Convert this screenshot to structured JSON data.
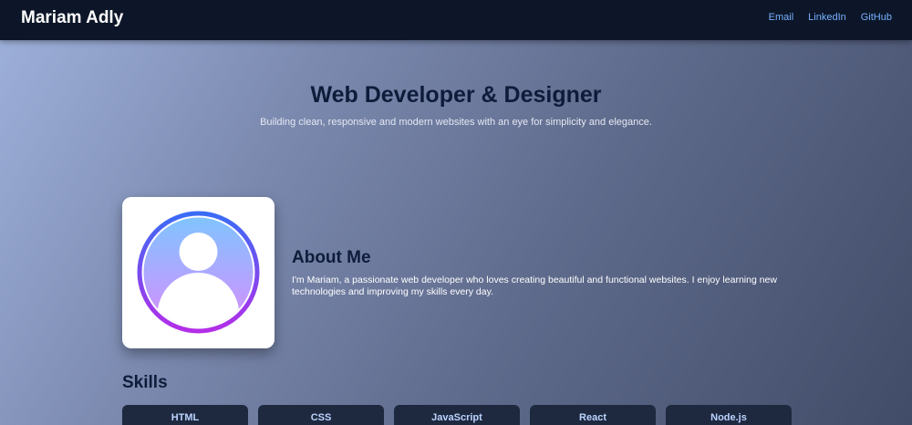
{
  "header": {
    "brand": "Mariam Adly",
    "links": [
      {
        "label": "Email"
      },
      {
        "label": "LinkedIn"
      },
      {
        "label": "GitHub"
      }
    ]
  },
  "hero": {
    "title": "Web Developer & Designer",
    "subtitle": "Building clean, responsive and modern websites with an eye for simplicity and elegance."
  },
  "about": {
    "title": "About Me",
    "text": "I'm Mariam, a passionate web developer who loves creating beautiful and functional websites. I enjoy learning new technologies and improving my skills every day."
  },
  "skills": {
    "title": "Skills",
    "items": [
      {
        "label": "HTML"
      },
      {
        "label": "CSS"
      },
      {
        "label": "JavaScript"
      },
      {
        "label": "React"
      },
      {
        "label": "Node.js"
      }
    ]
  },
  "icons": {
    "avatar": "user-avatar-icon"
  },
  "colors": {
    "nav_bg": "#0c1628",
    "link": "#78b0ff",
    "heading": "#0e1c3a",
    "skill_bg": "#1e293f",
    "avatar_ring_start": "#3b6cf6",
    "avatar_ring_end": "#b42ee8"
  }
}
